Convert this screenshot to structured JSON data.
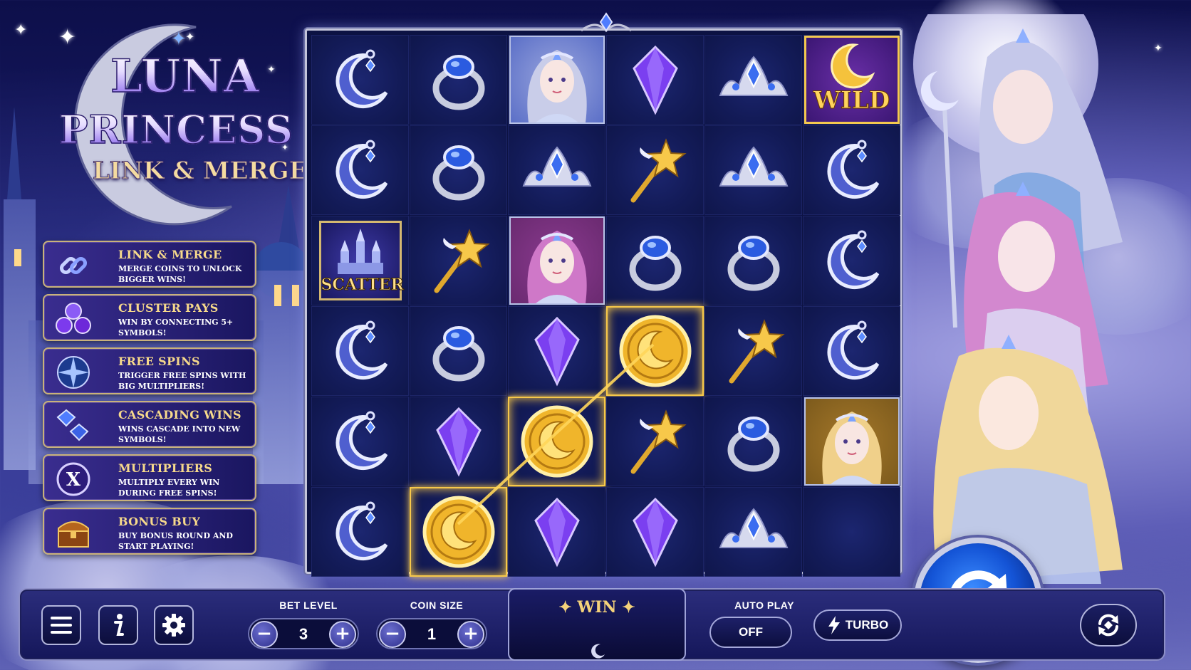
{
  "logo": {
    "line1": "LUNA",
    "line2": "PRINCESS",
    "line3": "LINK & MERGE"
  },
  "features": [
    {
      "icon": "chain-link-icon",
      "title": "LINK & MERGE",
      "desc": "MERGE COINS TO UNLOCK BIGGER WINS!"
    },
    {
      "icon": "gems-cluster-icon",
      "title": "CLUSTER PAYS",
      "desc": "WIN BY CONNECTING 5+ SYMBOLS!"
    },
    {
      "icon": "compass-star-icon",
      "title": "FREE SPINS",
      "desc": "TRIGGER FREE SPINS WITH BIG MULTIPLIERS!"
    },
    {
      "icon": "cascading-gems-icon",
      "title": "CASCADING WINS",
      "desc": "WINS CASCADE INTO NEW SYMBOLS!"
    },
    {
      "icon": "multiplier-x-icon",
      "title": "MULTIPLIERS",
      "desc": "MULTIPLY EVERY WIN DURING FREE SPINS!"
    },
    {
      "icon": "treasure-chest-icon",
      "title": "BONUS BUY",
      "desc": "BUY BONUS ROUND AND START PLAYING!"
    }
  ],
  "grid": [
    [
      "moon",
      "ring",
      "princess-silver",
      "crystal",
      "tiara",
      "wild"
    ],
    [
      "moon",
      "ring",
      "tiara",
      "wand",
      "tiara",
      "moon"
    ],
    [
      "scatter",
      "wand",
      "princess-pink",
      "ring",
      "ring",
      "moon"
    ],
    [
      "moon",
      "ring",
      "crystal",
      "coin",
      "wand",
      "moon"
    ],
    [
      "moon",
      "crystal",
      "coin",
      "wand",
      "ring",
      "princess-gold"
    ],
    [
      "moon",
      "coin",
      "crystal",
      "crystal",
      "tiara",
      "empty"
    ]
  ],
  "symbol_labels": {
    "wild": "WILD",
    "scatter": "SCATTER"
  },
  "controls": {
    "bet_level_label": "BET LEVEL",
    "bet_level_value": "3",
    "coin_size_label": "COIN SIZE",
    "coin_size_value": "1",
    "win_label": "✦ WIN ✦",
    "autoplay_label": "AUTO PLAY",
    "autoplay_value": "OFF",
    "turbo_label": "TURBO",
    "minus": "−",
    "plus": "+"
  },
  "colors": {
    "gold": "#f6d98b",
    "highlight": "#f7c84a",
    "spin_blue": "#1454d6"
  }
}
